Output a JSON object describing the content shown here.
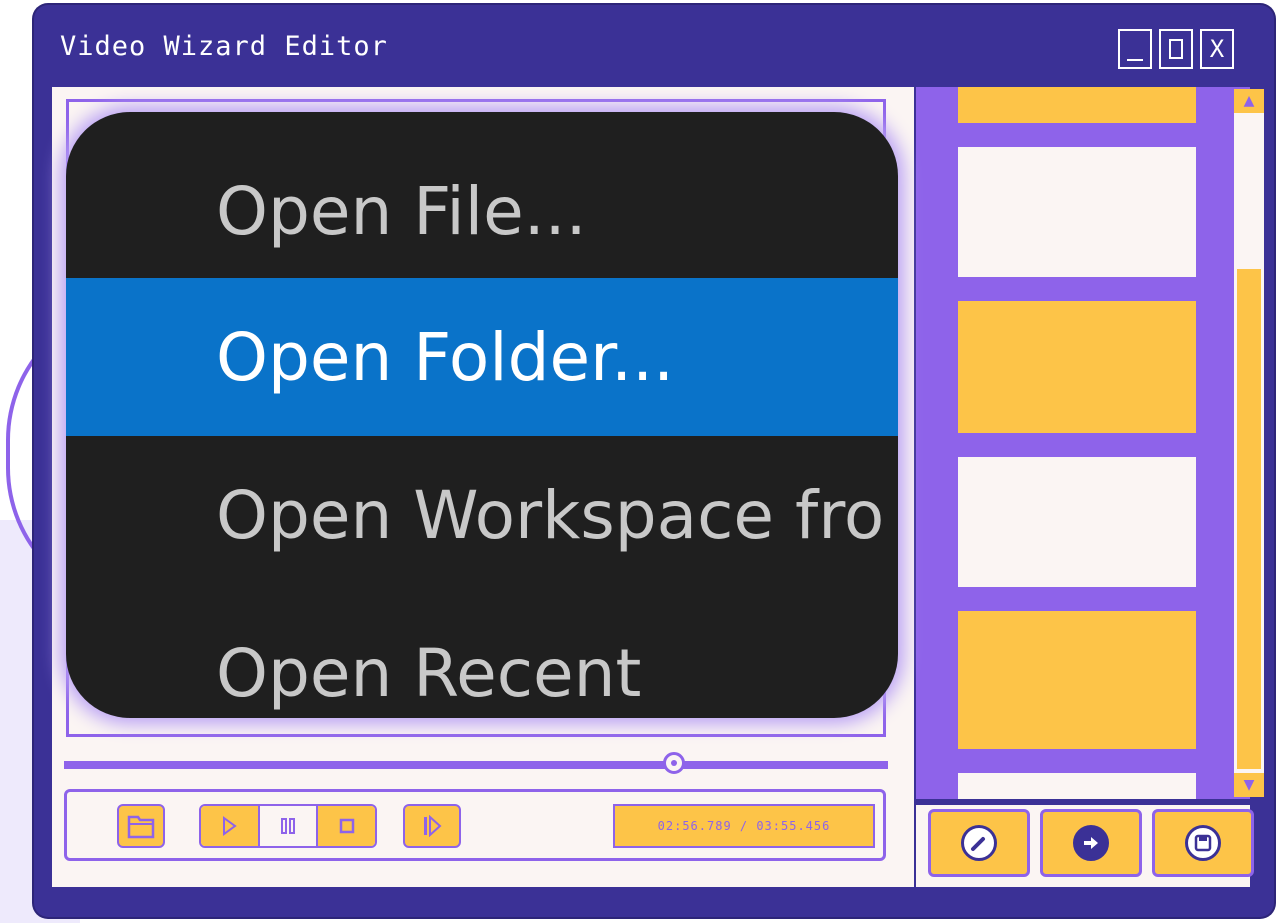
{
  "window": {
    "title": "Video Wizard Editor",
    "minimize_label": "_",
    "maximize_label": "",
    "close_label": "X"
  },
  "menu": {
    "items": [
      {
        "label": "Open File...",
        "selected": false
      },
      {
        "label": "Open Folder...",
        "selected": true
      },
      {
        "label": "Open Workspace fro",
        "selected": false
      },
      {
        "label": "Open Recent",
        "selected": false
      }
    ]
  },
  "playback": {
    "timecode": "02:56.789 / 03:55.456",
    "progress_fraction": 0.74,
    "open_icon": "folder-icon",
    "play_icon": "play-icon",
    "pause_icon": "pause-icon",
    "stop_icon": "stop-icon",
    "step_icon": "step-forward-icon"
  },
  "sidebar": {
    "clip_colors": [
      "#fdc448",
      "#fbf5f3",
      "#fdc448",
      "#fbf5f3",
      "#fdc448",
      "#fbf5f3"
    ],
    "action_icons": [
      "pencil-icon",
      "arrow-right-icon",
      "save-icon"
    ]
  },
  "colors": {
    "frame": "#3b3196",
    "accent": "#8e63ea",
    "highlight": "#fdc448",
    "panel": "#fbf5f3",
    "menu_bg": "#1f1f1f",
    "menu_selected": "#0a73c9"
  }
}
